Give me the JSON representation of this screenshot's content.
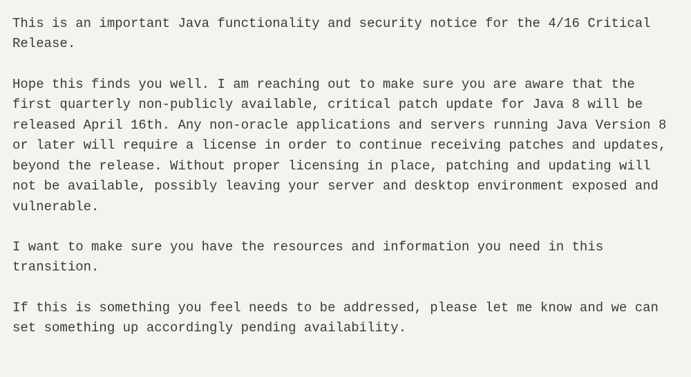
{
  "document": {
    "paragraphs": [
      "This is an important Java functionality and security notice for the 4/16 Critical Release.",
      "Hope this finds you well. I am reaching out to make sure you are aware that the first quarterly non-publicly available, critical patch update for Java 8 will be released April 16th. Any non-oracle applications and servers running Java Version 8 or later will require a license in order to continue receiving patches and updates, beyond the release.  Without proper licensing in place, patching and updating will not be available, possibly leaving your server and desktop environment exposed and vulnerable.",
      "I want to make sure you have the resources and information you need in this transition.",
      "If this is something you feel needs to be addressed, please let me know and we can set something up accordingly pending availability."
    ]
  }
}
